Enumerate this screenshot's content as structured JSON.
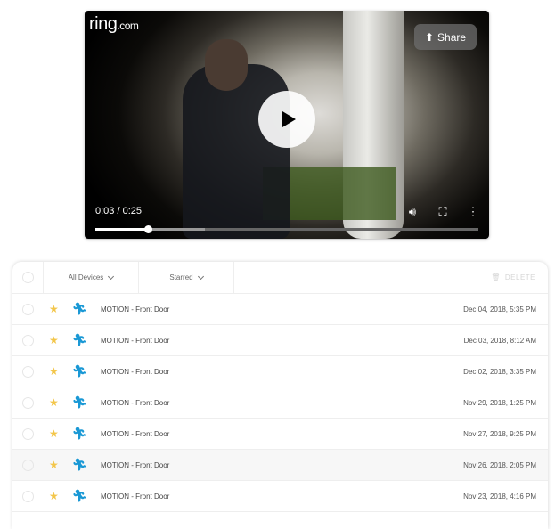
{
  "video": {
    "logo_main": "ring",
    "logo_suffix": ".com",
    "share_label": "Share",
    "current_time": "0:03",
    "duration": "0:25",
    "time_display": "0:03 / 0:25",
    "played_fraction": 0.137,
    "buffered_fraction": 0.285,
    "icons": {
      "share": "share-icon",
      "play": "play-icon",
      "volume": "volume-icon",
      "fullscreen": "fullscreen-icon",
      "more": "more-vert-icon"
    }
  },
  "events": {
    "filters": {
      "device": "All Devices",
      "starred": "Starred"
    },
    "delete_label": "DELETE",
    "accent_color": "#1998d5",
    "star_color": "#f3c64a",
    "rows": [
      {
        "type": "MOTION",
        "device": "Front Door",
        "label": "MOTION - Front Door",
        "date": "Dec 04, 2018, 5:35 PM",
        "highlighted": false
      },
      {
        "type": "MOTION",
        "device": "Front Door",
        "label": "MOTION - Front Door",
        "date": "Dec 03, 2018, 8:12 AM",
        "highlighted": false
      },
      {
        "type": "MOTION",
        "device": "Front Door",
        "label": "MOTION - Front Door",
        "date": "Dec 02, 2018, 3:35 PM",
        "highlighted": false
      },
      {
        "type": "MOTION",
        "device": "Front Door",
        "label": "MOTION - Front Door",
        "date": "Nov 29, 2018, 1:25 PM",
        "highlighted": false
      },
      {
        "type": "MOTION",
        "device": "Front Door",
        "label": "MOTION - Front Door",
        "date": "Nov 27, 2018, 9:25 PM",
        "highlighted": false
      },
      {
        "type": "MOTION",
        "device": "Front Door",
        "label": "MOTION - Front Door",
        "date": "Nov 26, 2018, 2:05 PM",
        "highlighted": true
      },
      {
        "type": "MOTION",
        "device": "Front Door",
        "label": "MOTION - Front Door",
        "date": "Nov 23, 2018, 4:16 PM",
        "highlighted": false
      }
    ]
  }
}
